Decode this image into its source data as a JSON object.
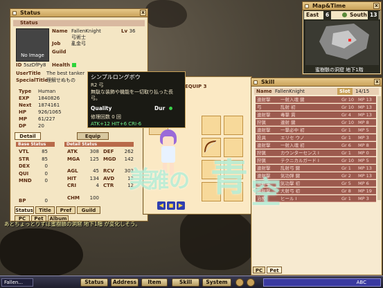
{
  "status": {
    "title": "Status",
    "section": "Status",
    "name_label": "Name",
    "name": "FallenKnight",
    "lv_label": "Lv",
    "lv": "36",
    "job_class": "弓術士",
    "job_label": "Job",
    "job": "亂金弓",
    "guild_label": "Guild",
    "no_image": "No Image",
    "id_label": "ID",
    "id": "5szDfPy8",
    "health_label": "Health",
    "user_title_label": "UserTitle",
    "user_title": "The best tanker",
    "special_title_label": "SpecialTitle",
    "special_title": "理解せぬもの",
    "type_label": "Type",
    "type": "Human",
    "exp_label": "EXP",
    "exp": "1840826",
    "next_label": "Next",
    "next": "1874161",
    "hp_label": "HP",
    "hp": "926/1065",
    "mp_label": "MP",
    "mp": "61/227",
    "dp_label": "DP",
    "dp": "20",
    "detail_label": "Detail",
    "equip_label": "Equip",
    "base_status_label": "Base Status",
    "detail_status_label": "Detail Status",
    "base": [
      {
        "k": "VTL",
        "v": "85"
      },
      {
        "k": "STR",
        "v": "85"
      },
      {
        "k": "DEX",
        "v": "0"
      },
      {
        "k": "QUI",
        "v": "0"
      },
      {
        "k": "MND",
        "v": "0"
      },
      {
        "k": "BP",
        "v": "0"
      }
    ],
    "detail": [
      {
        "k": "ATK",
        "v": "308",
        "k2": "DEF",
        "v2": "262"
      },
      {
        "k": "MGA",
        "v": "125",
        "k2": "MGD",
        "v2": "142"
      },
      {
        "k": "AGL",
        "v": "45",
        "k2": "RCV",
        "v2": "303"
      },
      {
        "k": "HIT",
        "v": "134",
        "k2": "AVD",
        "v2": "12"
      },
      {
        "k": "CRI",
        "v": "4",
        "k2": "CTR",
        "v2": "12"
      },
      {
        "k": "CHM",
        "v": "100",
        "k2": "",
        "v2": ""
      }
    ],
    "tabs": [
      "Status",
      "Title",
      "Pref",
      "Guild"
    ],
    "tabs2": [
      "PC",
      "Pet",
      "Album"
    ]
  },
  "tooltip": {
    "name": "シンプルロングボウ",
    "type": "R2 弓",
    "desc": "無駄な装飾や機能を一切取り払った長弓。",
    "quality_label": "Quality",
    "dur_label": "Dur",
    "repair": "修理回数 0 回",
    "stats": "ATK+12 HIT+6 CRI-6"
  },
  "equip": {
    "label": "EQUIP 3"
  },
  "map": {
    "title": "Map&Time",
    "dir1": "East",
    "num1": "6",
    "dir2": "South",
    "num2": "13",
    "location": "蜜樹骸の洞窟 地下1階"
  },
  "skill": {
    "title": "Skill",
    "name_label": "Name",
    "name": "FallenKnight",
    "slot_label": "Slot",
    "slot": "14/15",
    "rows": [
      {
        "nm": "連射撃",
        "ds": "一射入魂 鍵",
        "lv": "Gr 10",
        "mp": "MP 13"
      },
      {
        "nm": "弓",
        "ds": "乱射 初",
        "lv": "Gr 10",
        "mp": "MP 13"
      },
      {
        "nm": "連射撃",
        "ds": "毒撃 貫",
        "lv": "Gr 4",
        "mp": "MP 13"
      },
      {
        "nm": "狩猟",
        "ds": "連射 鍵",
        "lv": "Gr 10",
        "mp": "MP 8"
      },
      {
        "nm": "連射撃",
        "ds": "一撃必中 初",
        "lv": "Gr 1",
        "mp": "MP 5"
      },
      {
        "nm": "投具",
        "ds": "エリセ ウノ",
        "lv": "Gr 1",
        "mp": "MP 3"
      },
      {
        "nm": "連射撃",
        "ds": "一射入魂 初",
        "lv": "Gr 6",
        "mp": "MP 8"
      },
      {
        "nm": "狩猟",
        "ds": "カウンターセンス I",
        "lv": "Gr 1",
        "mp": "MP 0"
      },
      {
        "nm": "狩猟",
        "ds": "テクニカルガード I",
        "lv": "Gr 10",
        "mp": "MP 5"
      },
      {
        "nm": "連射撃",
        "ds": "乱射弓 鍵",
        "lv": "Gr 1",
        "mp": "MP 13"
      },
      {
        "nm": "連射撃",
        "ds": "気功弾 鍵",
        "lv": "Gr 2",
        "mp": "MP 13"
      },
      {
        "nm": "連射撃",
        "ds": "気功撃 初",
        "lv": "Gr 5",
        "mp": "MP 6"
      },
      {
        "nm": "連射撃",
        "ds": "大射弓 初",
        "lv": "Gr 8",
        "mp": "MP 19"
      },
      {
        "nm": "治療",
        "ds": "ヒール I",
        "lv": "Gr 1",
        "mp": "MP 3"
      }
    ],
    "tabs": [
      "PC",
      "Pet 1"
    ]
  },
  "chat": {
    "line": "あとちょっとりずぼ蜜樹骸の洞窟 地下1階 が変化しそう。"
  },
  "bottom": {
    "chat_input": "Fallen...",
    "buttons": [
      "Status",
      "Address",
      "Item",
      "Skill",
      "System"
    ],
    "ime": "ABC"
  },
  "watermark": {
    "text1": "美",
    "text2": "雅の",
    "text3": "青",
    "text4": "空"
  }
}
